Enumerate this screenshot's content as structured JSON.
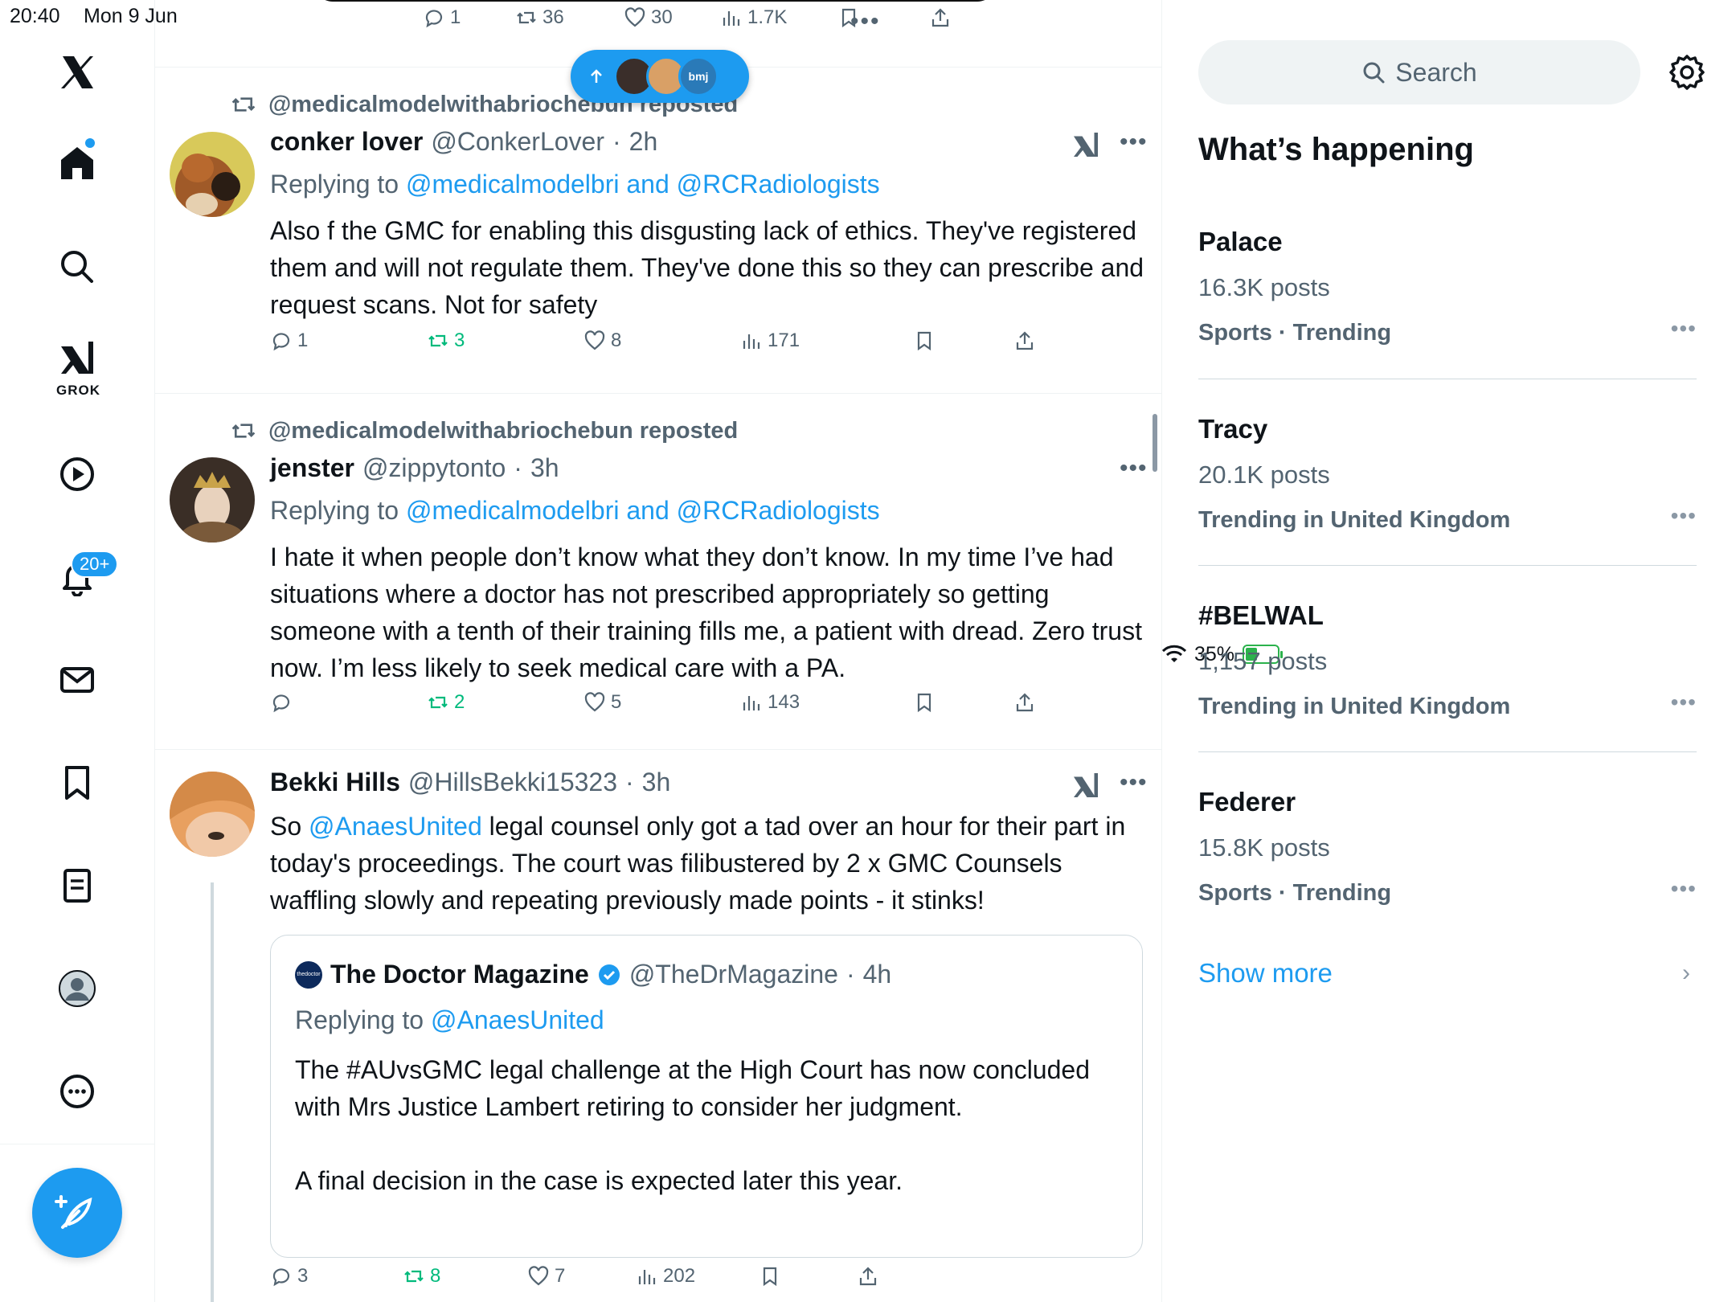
{
  "status": {
    "time": "20:40",
    "date": "Mon 9 Jun",
    "battery": "35%"
  },
  "nav": {
    "notifications_badge": "20+",
    "grok_label": "GROK"
  },
  "top_tweet_actions": {
    "replies": "1",
    "reposts": "36",
    "likes": "30",
    "views": "1.7K"
  },
  "pill": {
    "avatar_label": "bmj"
  },
  "tweets": [
    {
      "reposted_by": "@medicalmodelwithabriochebun reposted",
      "name": "conker lover",
      "handle": "@ConkerLover",
      "time": "2h",
      "replying_prefix": "Replying to ",
      "replying_to": "@medicalmodelbri and @RCRadiologists",
      "text": "Also f the GMC for enabling this disgusting lack of ethics. They've registered them and will not regulate them. They've done this so they can prescribe and request scans. Not for safety",
      "replies": "1",
      "reposts": "3",
      "likes": "8",
      "views": "171"
    },
    {
      "reposted_by": "@medicalmodelwithabriochebun reposted",
      "name": "jenster",
      "handle": "@zippytonto",
      "time": "3h",
      "replying_prefix": "Replying to ",
      "replying_to": "@medicalmodelbri and @RCRadiologists",
      "text": "I hate it when people don’t know what they don’t know. In my time I’ve had situations where a doctor has not prescribed appropriately so getting someone with a tenth of their training fills me, a patient with dread. Zero trust now. I’m less likely to seek medical care with a PA.",
      "replies": "",
      "reposts": "2",
      "likes": "5",
      "views": "143"
    },
    {
      "name": "Bekki Hills",
      "handle": "@HillsBekki15323",
      "time": "3h",
      "text_prefix": "So ",
      "text_mention": "@AnaesUnited",
      "text_rest": " legal counsel only got a tad over an hour for their part in today's proceedings. The court was filibustered by 2 x GMC Counsels waffling slowly and repeating previously made points - it stinks!",
      "replies": "3",
      "reposts": "8",
      "likes": "7",
      "views": "202"
    }
  ],
  "quote": {
    "logo_text": "thedoctor",
    "name": "The Doctor Magazine",
    "handle": "@TheDrMagazine",
    "time": "4h",
    "replying_prefix": "Replying to ",
    "replying_to": "@AnaesUnited",
    "text": "The #AUvsGMC legal challenge at the High Court has now concluded with Mrs Justice Lambert retiring to consider her judgment.\n\nA final decision in the case is expected later this year."
  },
  "sidebar": {
    "search_placeholder": "Search",
    "title": "What’s happening",
    "trends": [
      {
        "name": "Palace",
        "posts": "16.3K posts",
        "category": "Sports · Trending"
      },
      {
        "name": "Tracy",
        "posts": "20.1K posts",
        "category": "Trending in United Kingdom"
      },
      {
        "name": "#BELWAL",
        "posts": "1,157 posts",
        "category": "Trending in United Kingdom"
      },
      {
        "name": "Federer",
        "posts": "15.8K posts",
        "category": "Sports · Trending"
      }
    ],
    "show_more": "Show more"
  },
  "colors": {
    "accent": "#1d9bf0",
    "repost_active": "#00ba7c",
    "muted": "#536471"
  }
}
